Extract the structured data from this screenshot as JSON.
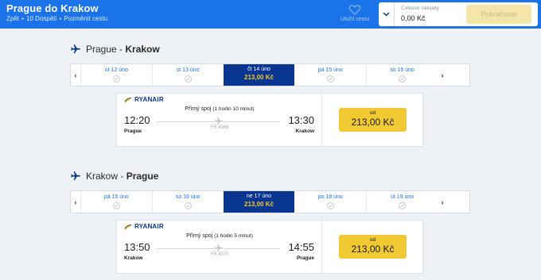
{
  "header": {
    "title": "Prague do Krakow",
    "back": "Zpět",
    "passengers": "10 Dospělí",
    "change": "Pozměnit cestu",
    "save_label": "Uložit cestu",
    "total_label": "Celkové náklady",
    "total_value": "0,00 Kč",
    "continue_label": "Pokračovat"
  },
  "outbound": {
    "from": "Prague",
    "sep": " - ",
    "to": "Krakow",
    "days": [
      {
        "label": "út 12 úno"
      },
      {
        "label": "st 13 úno"
      },
      {
        "label": "čt 14 úno",
        "price": "213,00 Kč"
      },
      {
        "label": "pá 15 úno"
      },
      {
        "label": "so 16 úno"
      }
    ],
    "flight": {
      "airline": "RYANAIR",
      "type": "Přímý spoj",
      "duration": "(1 hodin 10 minut)",
      "dep_time": "12:20",
      "arr_time": "13:30",
      "dep_city": "Prague",
      "arr_city": "Krakow",
      "flight_no": "FR 4069",
      "price_from": "od",
      "price": "213,00 Kč"
    }
  },
  "inbound": {
    "from": "Krakow",
    "sep": " - ",
    "to": "Prague",
    "days": [
      {
        "label": "pá 15 úno"
      },
      {
        "label": "so 16 úno"
      },
      {
        "label": "ne 17 úno",
        "price": "213,00 Kč"
      },
      {
        "label": "po 18 úno"
      },
      {
        "label": "út 19 úno"
      }
    ],
    "flight": {
      "airline": "RYANAIR",
      "type": "Přímý spoj",
      "duration": "(1 hodin 5 minut)",
      "dep_time": "13:50",
      "arr_time": "14:55",
      "dep_city": "Krakow",
      "arr_city": "Prague",
      "flight_no": "FR 4070",
      "price_from": "od",
      "price": "213,00 Kč"
    }
  },
  "colors": {
    "header_bg": "#1a73e8",
    "selected_day_bg": "#073590",
    "price_yellow": "#f1c933"
  }
}
